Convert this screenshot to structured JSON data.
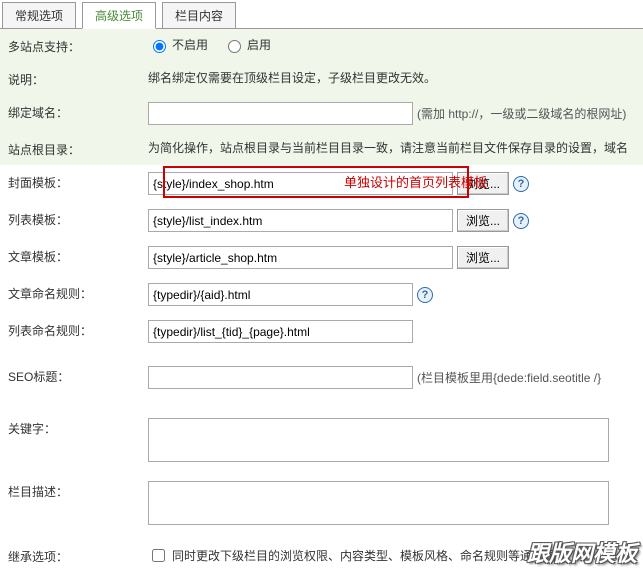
{
  "tabs": [
    "常规选项",
    "高级选项",
    "栏目内容"
  ],
  "multiSite": {
    "label": "多站点支持：",
    "opt1": "不启用",
    "opt2": "启用"
  },
  "desc": {
    "label": "说明：",
    "text": "绑名绑定仅需要在顶级栏目设定，子级栏目更改无效。"
  },
  "bindDomain": {
    "label": "绑定域名：",
    "value": "",
    "hint": "(需加 http://，一级或二级域名的根网址)"
  },
  "siteRoot": {
    "label": "站点根目录：",
    "text": "为简化操作，站点根目录与当前栏目目录一致，请注意当前栏目文件保存目录的设置，域名"
  },
  "coverTpl": {
    "label": "封面模板：",
    "value": "{style}/index_shop.htm",
    "btn": "浏览..."
  },
  "listTpl": {
    "label": "列表模板：",
    "value": "{style}/list_index.htm",
    "btn": "浏览..."
  },
  "articleTpl": {
    "label": "文章模板：",
    "value": "{style}/article_shop.htm",
    "btn": "浏览..."
  },
  "articleRule": {
    "label": "文章命名规则：",
    "value": "{typedir}/{aid}.html"
  },
  "listRule": {
    "label": "列表命名规则：",
    "value": "{typedir}/list_{tid}_{page}.html"
  },
  "seoTitle": {
    "label": "SEO标题：",
    "value": "",
    "hint": "(栏目模板里用{dede:field.seotitle /}"
  },
  "keywords": {
    "label": "关键字：",
    "value": ""
  },
  "colDesc": {
    "label": "栏目描述：",
    "value": ""
  },
  "inherit": {
    "label": "继承选项：",
    "text": "同时更改下级栏目的浏览权限、内容类型、模板风格、命名规则等通用属性"
  },
  "annotation": "单独设计的首页列表模板",
  "watermark": "跟版网模板"
}
